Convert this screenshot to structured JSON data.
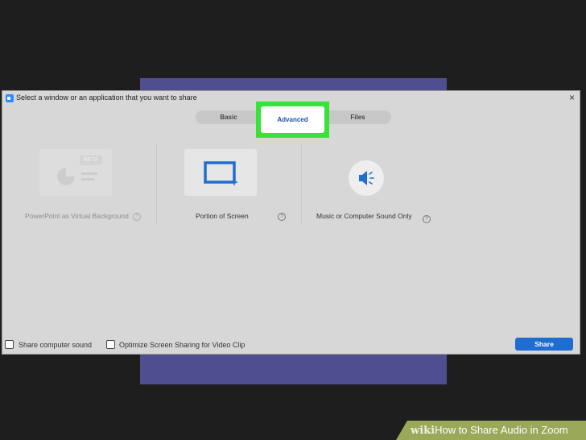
{
  "dialog": {
    "title": "Select a window or an application that you want to share",
    "close_glyph": "×"
  },
  "tabs": {
    "basic": "Basic",
    "advanced": "Advanced",
    "files": "Files",
    "selected": "Advanced"
  },
  "options": {
    "powerpoint": {
      "label": "PowerPoint as Virtual Background",
      "badge": "BETA",
      "help": "?"
    },
    "portion": {
      "label": "Portion of Screen",
      "help": "?"
    },
    "sound": {
      "label": "Music or Computer Sound Only",
      "help": "?"
    }
  },
  "footer": {
    "share_sound": "Share computer sound",
    "optimize": "Optimize Screen Sharing for Video Clip",
    "share_button": "Share"
  },
  "banner": {
    "brand": "wiki",
    "title": "How to Share Audio in Zoom"
  },
  "colors": {
    "highlight": "#36e336",
    "accent": "#1f6dd0",
    "advanced_text": "#1d4fa8"
  }
}
